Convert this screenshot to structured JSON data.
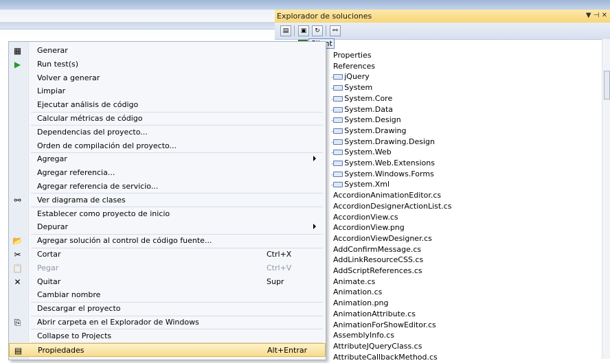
{
  "solution_explorer": {
    "title": "Explorador de soluciones",
    "window_controls": "▼ ⊣ ✕",
    "root_label": "Client",
    "nodes": [
      {
        "label": "Properties",
        "ref": false
      },
      {
        "label": "References",
        "ref": false
      },
      {
        "label": "jQuery",
        "ref": true
      },
      {
        "label": "System",
        "ref": true
      },
      {
        "label": "System.Core",
        "ref": true
      },
      {
        "label": "System.Data",
        "ref": true
      },
      {
        "label": "System.Design",
        "ref": true
      },
      {
        "label": "System.Drawing",
        "ref": true
      },
      {
        "label": "System.Drawing.Design",
        "ref": true
      },
      {
        "label": "System.Web",
        "ref": true
      },
      {
        "label": "System.Web.Extensions",
        "ref": true
      },
      {
        "label": "System.Windows.Forms",
        "ref": true
      },
      {
        "label": "System.Xml",
        "ref": true
      },
      {
        "label": "AccordionAnimationEditor.cs",
        "ref": false
      },
      {
        "label": "AccordionDesignerActionList.cs",
        "ref": false
      },
      {
        "label": "AccordionView.cs",
        "ref": false
      },
      {
        "label": "AccordionView.png",
        "ref": false
      },
      {
        "label": "AccordionViewDesigner.cs",
        "ref": false
      },
      {
        "label": "AddConfirmMessage.cs",
        "ref": false
      },
      {
        "label": "AddLinkResourceCSS.cs",
        "ref": false
      },
      {
        "label": "AddScriptReferences.cs",
        "ref": false
      },
      {
        "label": "Animate.cs",
        "ref": false
      },
      {
        "label": "Animation.cs",
        "ref": false
      },
      {
        "label": "Animation.png",
        "ref": false
      },
      {
        "label": "AnimationAttribute.cs",
        "ref": false
      },
      {
        "label": "AnimationForShowEditor.cs",
        "ref": false
      },
      {
        "label": "AssemblyInfo.cs",
        "ref": false
      },
      {
        "label": "AttributeJQueryClass.cs",
        "ref": false
      },
      {
        "label": "AttributeCallbackMethod.cs",
        "ref": false
      }
    ]
  },
  "context_menu": {
    "items": [
      {
        "label": "Generar",
        "icon": "build-icon",
        "glyph": "▦"
      },
      {
        "label": "Run test(s)",
        "icon": "run-test-icon",
        "glyph": "▶"
      },
      {
        "label": "Volver a generar"
      },
      {
        "label": "Limpiar"
      },
      {
        "label": "Ejecutar análisis de código",
        "sep_after": true
      },
      {
        "label": "Calcular métricas de código",
        "sep_after": true
      },
      {
        "label": "Dependencias del proyecto..."
      },
      {
        "label": "Orden de compilación del proyecto...",
        "sep_after": true
      },
      {
        "label": "Agregar",
        "submenu": true
      },
      {
        "label": "Agregar referencia..."
      },
      {
        "label": "Agregar referencia de servicio...",
        "sep_after": true
      },
      {
        "label": "Ver diagrama de clases",
        "icon": "class-diagram-icon",
        "glyph": "⚯",
        "sep_after": true
      },
      {
        "label": "Establecer como proyecto de inicio"
      },
      {
        "label": "Depurar",
        "submenu": true,
        "sep_after": true
      },
      {
        "label": "Agregar solución al control de código fuente...",
        "icon": "source-control-icon",
        "glyph": "📂",
        "sep_after": true
      },
      {
        "label": "Cortar",
        "shortcut": "Ctrl+X",
        "icon": "cut-icon",
        "glyph": "✂"
      },
      {
        "label": "Pegar",
        "shortcut": "Ctrl+V",
        "icon": "paste-icon",
        "glyph": "📋",
        "disabled": true
      },
      {
        "label": "Quitar",
        "shortcut": "Supr",
        "icon": "delete-icon",
        "glyph": "✕"
      },
      {
        "label": "Cambiar nombre",
        "sep_after": true
      },
      {
        "label": "Descargar el proyecto",
        "sep_after": true
      },
      {
        "label": "Abrir carpeta en el Explorador de Windows",
        "icon": "open-folder-icon",
        "glyph": "⎘",
        "sep_after": true
      },
      {
        "label": "Collapse to Projects",
        "sep_after": true
      },
      {
        "label": "Propiedades",
        "shortcut": "Alt+Entrar",
        "icon": "properties-icon",
        "glyph": "▤",
        "highlighted": true
      }
    ]
  }
}
